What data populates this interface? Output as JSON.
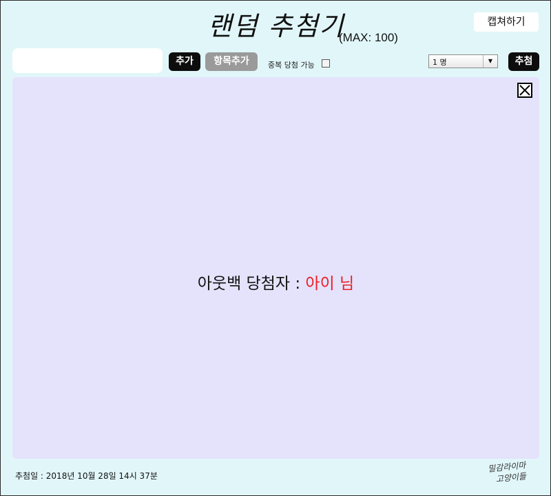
{
  "header": {
    "title": "랜덤 추첨기",
    "max_label": "(MAX: 100)",
    "capture_label": "캡쳐하기"
  },
  "toolbar": {
    "item_input_value": "",
    "add_label": "추가",
    "add_items_label": "항목추가",
    "duplicate_label": "중복 당첨 가능",
    "duplicate_checked": false,
    "count_selected": "1 명",
    "draw_label": "추첨"
  },
  "panel": {
    "result_prefix": "아웃백 당첨자 : ",
    "winner": "아이 님"
  },
  "footer": {
    "draw_date": "추첨일 :  2018년 10월 28일 14시 37분",
    "signature_line1": "밀감라이마",
    "signature_line2": "고양이들"
  },
  "colors": {
    "background": "#e1f6f9",
    "panel": "#e4e3fb",
    "winner": "#ee1c25",
    "dark_button": "#0d0d0d",
    "gray_button": "#9a9a9a"
  }
}
